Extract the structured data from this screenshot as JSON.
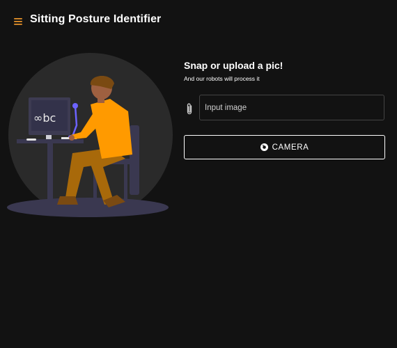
{
  "app": {
    "title": "Sitting Posture Identifier",
    "accent_color": "#e8932b",
    "background_color": "#121212"
  },
  "menu": {
    "icon": "hamburger-menu-icon"
  },
  "illustration": {
    "monitor_text": "∞bc"
  },
  "upload": {
    "heading": "Snap or upload a pic!",
    "subheading": "And our robots will process it",
    "attach_icon": "paperclip-icon",
    "input_placeholder": "Input image",
    "camera_icon": "camera-icon",
    "camera_label": "CAMERA"
  }
}
